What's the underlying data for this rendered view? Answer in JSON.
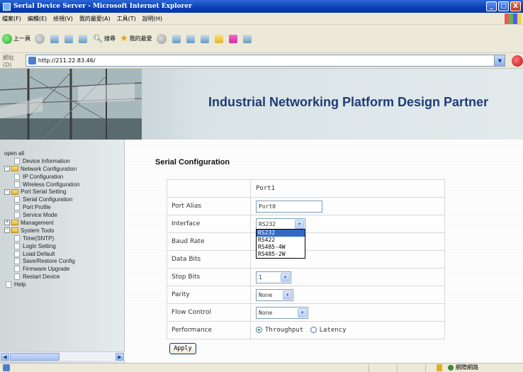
{
  "window": {
    "title": "Serial Device Server - Microsoft Internet Explorer",
    "buttons": [
      "_",
      "□",
      "X"
    ]
  },
  "menubar": [
    "檔案(F)",
    "編輯(E)",
    "檢視(V)",
    "我的最愛(A)",
    "工具(T)",
    "說明(H)"
  ],
  "toolbar": {
    "back_label": "上一頁",
    "search_label": "搜尋",
    "favorites_label": "我的最愛"
  },
  "address": {
    "label": "網址(D)",
    "url": "http://211.22.83.46/"
  },
  "banner": {
    "title": "Industrial Networking Platform Design Partner"
  },
  "tree": {
    "open_all": "open all",
    "items": [
      {
        "label": "Device Information",
        "level": 1,
        "type": "doc"
      },
      {
        "label": "Network Configuration",
        "level": 1,
        "type": "folder",
        "expander": "-"
      },
      {
        "label": "IP Configuration",
        "level": 2,
        "type": "doc"
      },
      {
        "label": "Wireless Configuration",
        "level": 2,
        "type": "doc"
      },
      {
        "label": "Port Serial Setting",
        "level": 1,
        "type": "folder",
        "expander": "-"
      },
      {
        "label": "Serial Configuration",
        "level": 2,
        "type": "doc"
      },
      {
        "label": "Port Profile",
        "level": 2,
        "type": "doc"
      },
      {
        "label": "Service Mode",
        "level": 2,
        "type": "doc"
      },
      {
        "label": "Management",
        "level": 1,
        "type": "folder",
        "expander": "+"
      },
      {
        "label": "System Tools",
        "level": 1,
        "type": "folder",
        "expander": "-"
      },
      {
        "label": "Time(SNTP)",
        "level": 2,
        "type": "doc"
      },
      {
        "label": "Login Setting",
        "level": 2,
        "type": "doc"
      },
      {
        "label": "Load Default",
        "level": 2,
        "type": "doc"
      },
      {
        "label": "Save/Restore Config",
        "level": 2,
        "type": "doc"
      },
      {
        "label": "Firmware Upgrade",
        "level": 2,
        "type": "doc"
      },
      {
        "label": "Restart Device",
        "level": 2,
        "type": "doc"
      },
      {
        "label": "Help",
        "level": 1,
        "type": "doc"
      }
    ]
  },
  "main": {
    "title": "Serial Configuration",
    "port_header": "Port1",
    "rows": {
      "port_alias": {
        "label": "Port Alias",
        "value": "Port0"
      },
      "interface": {
        "label": "Interface",
        "value": "RS232"
      },
      "baud_rate": {
        "label": "Baud Rate"
      },
      "data_bits": {
        "label": "Data Bits"
      },
      "stop_bits": {
        "label": "Stop Bits",
        "value": "1"
      },
      "parity": {
        "label": "Parity",
        "value": "None"
      },
      "flow_control": {
        "label": "Flow Control",
        "value": "None"
      },
      "performance": {
        "label": "Performance",
        "options": [
          "Throughput",
          "Latency"
        ],
        "selected": "Throughput"
      }
    },
    "interface_options": [
      "RS232",
      "RS422",
      "RS485-4W",
      "RS485-2W"
    ],
    "apply_label": "Apply"
  },
  "status": {
    "zone": "網際網路"
  }
}
